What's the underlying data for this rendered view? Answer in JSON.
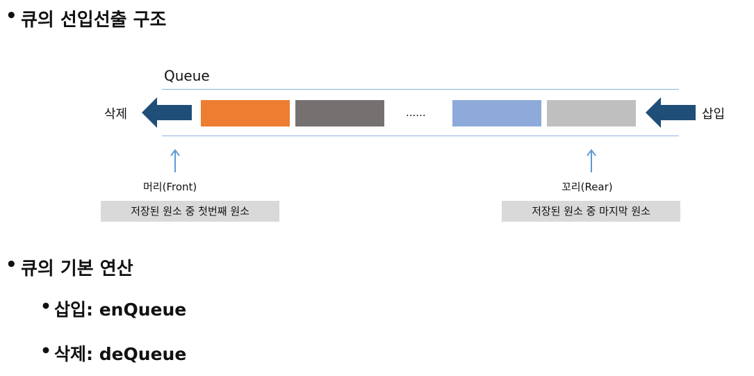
{
  "heading_structure": "큐의 선입선출 구조",
  "diagram": {
    "queue_label": "Queue",
    "delete_label": "삭제",
    "insert_label": "삽입",
    "ellipsis": "......",
    "front_label": "머리(Front)",
    "rear_label": "꼬리(Rear)",
    "front_desc": "저장된 원소 중 첫번째 원소",
    "rear_desc": "저장된 원소 중 마지막 원소",
    "colors": {
      "arrow": "#1f4e79",
      "pointer": "#5b9bd5",
      "line": "#8db3e2",
      "block_orange": "#ed7d31",
      "block_dark": "#767171",
      "block_blue": "#8eaadb",
      "block_gray": "#bfbfbf",
      "desc_bg": "#d9d9d9"
    }
  },
  "heading_ops": "큐의 기본 연산",
  "ops": [
    "삽입: enQueue",
    "삭제: deQueue"
  ]
}
